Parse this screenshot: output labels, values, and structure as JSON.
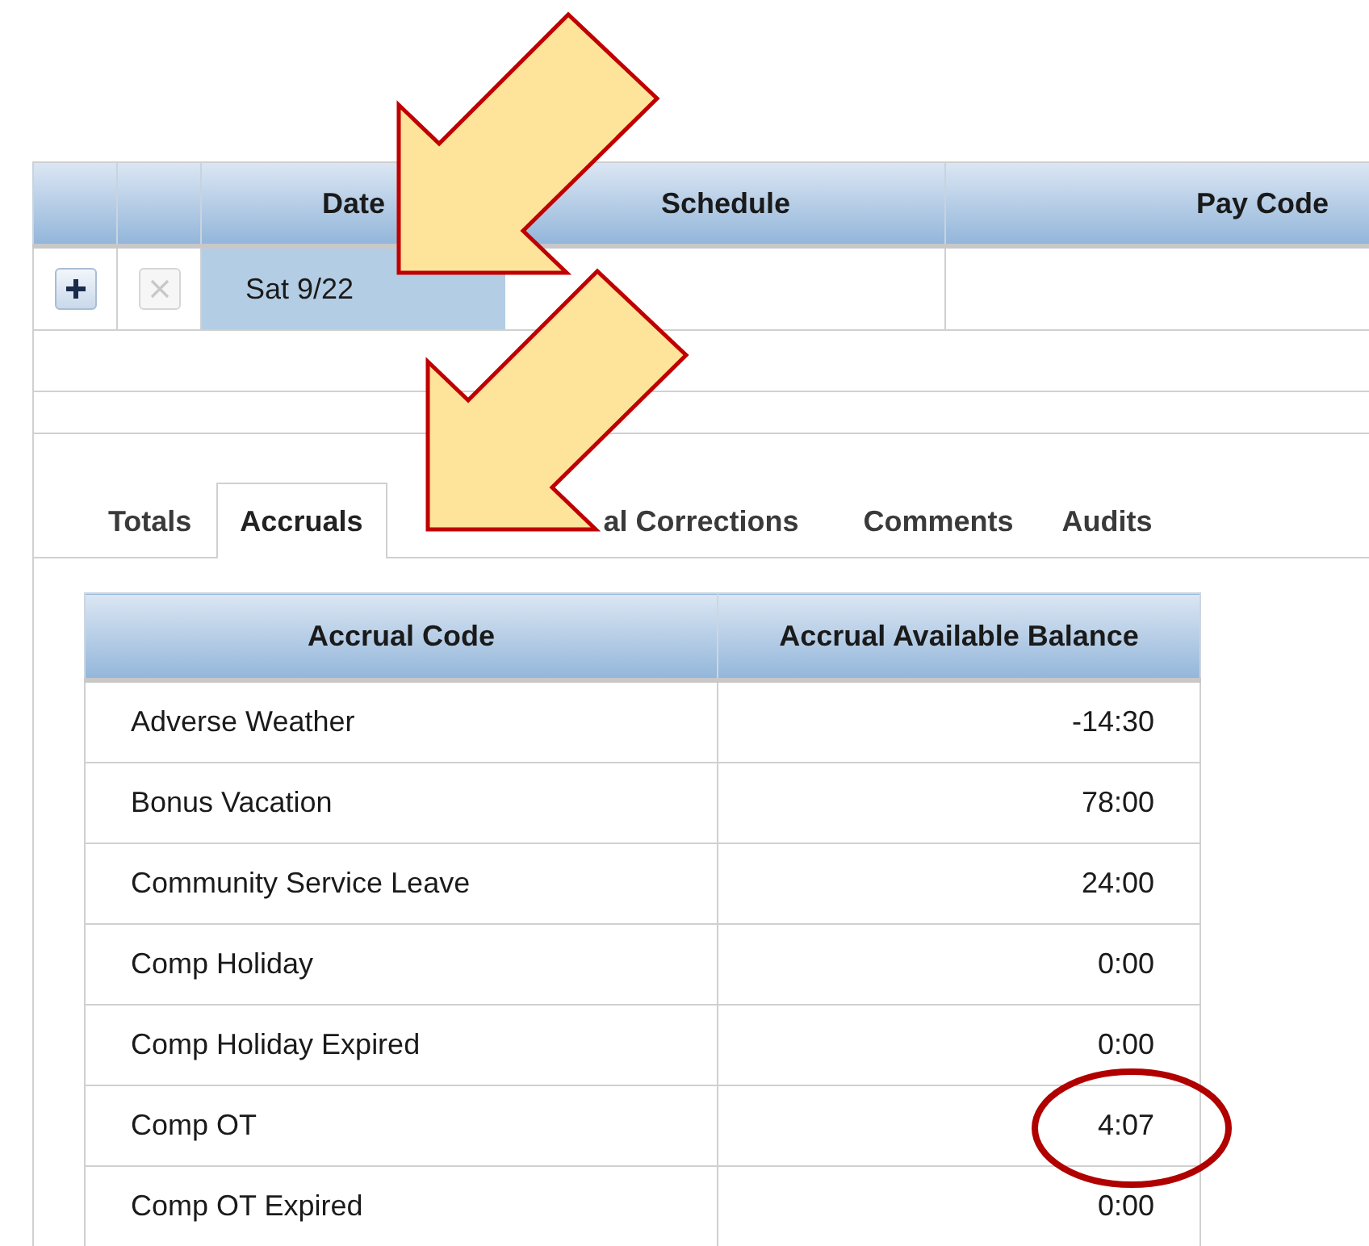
{
  "timecard": {
    "columns": [
      "Date",
      "Schedule",
      "Pay Code"
    ],
    "rows": [
      {
        "actions": [
          {
            "kind": "add",
            "disabled": false
          },
          {
            "kind": "delete",
            "disabled": true
          }
        ],
        "date": "Sat 9/22",
        "selected": true
      }
    ]
  },
  "tabs": [
    {
      "label": "Totals",
      "selected": false
    },
    {
      "label": "Accruals",
      "selected": true
    },
    {
      "label": "al Corrections",
      "selected": false
    },
    {
      "label": "Comments",
      "selected": false
    },
    {
      "label": "Audits",
      "selected": false
    }
  ],
  "accruals": {
    "columns": [
      "Accrual Code",
      "Accrual Available Balance"
    ],
    "rows": [
      {
        "code": "Adverse Weather",
        "balance": "-14:30",
        "circled": false
      },
      {
        "code": "Bonus Vacation",
        "balance": "78:00",
        "circled": false
      },
      {
        "code": "Community Service Leave",
        "balance": "24:00",
        "circled": false
      },
      {
        "code": "Comp Holiday",
        "balance": "0:00",
        "circled": false
      },
      {
        "code": "Comp Holiday Expired",
        "balance": "0:00",
        "circled": false
      },
      {
        "code": "Comp OT",
        "balance": "4:07",
        "circled": true
      },
      {
        "code": "Comp OT Expired",
        "balance": "0:00",
        "circled": false
      }
    ]
  }
}
